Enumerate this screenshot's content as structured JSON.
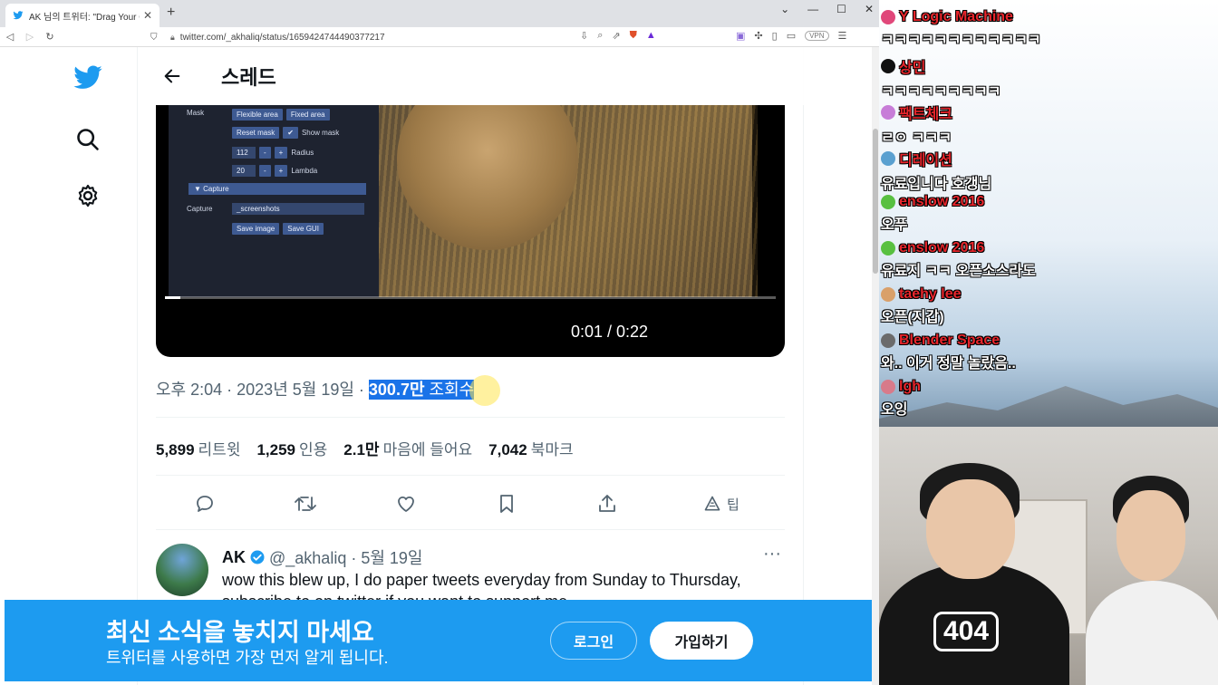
{
  "browser": {
    "tab_title": "AK 님의 트위터: \"Drag Your GAN",
    "tab_close": "✕",
    "new_tab": "+",
    "url": "twitter.com/_akhaliq/status/1659424744490377217",
    "vpn_label": "VPN",
    "window_controls": [
      "⌄",
      "—",
      "☐",
      "✕"
    ]
  },
  "header": {
    "title": "스레드"
  },
  "video_gui": {
    "mask_label": "Mask",
    "flexible_area": "Flexible area",
    "fixed_area": "Fixed area",
    "reset_mask": "Reset mask",
    "show_mask": "Show mask",
    "radius_value": "112",
    "radius_label": "Radius",
    "lambda_value": "20",
    "lambda_label": "Lambda",
    "capture_header": "Capture",
    "capture_label": "Capture",
    "capture_path": "_screenshots",
    "save_image": "Save image",
    "save_gui": "Save GUI",
    "minus": "-",
    "plus": "+"
  },
  "video": {
    "time": "0:01 / 0:22",
    "progress": 0.025
  },
  "tweet": {
    "meta_prefix": "오후 2:04 · 2023년 5월 19일 · ",
    "views_count": "300.7만",
    "views_label": " 조회수"
  },
  "stats": [
    {
      "count": "5,899",
      "label": "리트윗"
    },
    {
      "count": "1,259",
      "label": "인용"
    },
    {
      "count": "2.1만",
      "label": "마음에 들어요"
    },
    {
      "count": "7,042",
      "label": "북마크"
    }
  ],
  "actions": {
    "tip_label": "팁"
  },
  "reply": {
    "name": "AK",
    "handle_date": "@_akhaliq · 5월 19일",
    "more": "···",
    "text_line1": "wow this blew up, I do paper tweets everyday from Sunday to Thursday,",
    "text_line2": "subscribe to on twitter if you want to support me"
  },
  "banner": {
    "title": "최신 소식을 놓치지 마세요",
    "subtitle": "트위터를 사용하면 가장 먼저 알게 됩니다.",
    "login": "로그인",
    "signup": "가입하기"
  },
  "chat": [
    {
      "user": "Y Logic Machine",
      "msg": "ㅋㅋㅋㅋㅋㅋㅋㅋㅋㅋㅋㅋ",
      "badge": "#e0477a"
    },
    {
      "user": "상민",
      "msg": "ㅋㅋㅋㅋㅋㅋㅋㅋㅋ",
      "badge": "#111111"
    },
    {
      "user": "팩트체크",
      "msg": "ㄹㅇ ㅋㅋㅋ",
      "badge": "#c77dd8"
    },
    {
      "user": "디레이션",
      "msg": "유료입니다 호갱님",
      "badge": "#5aa0d0"
    },
    {
      "user": "enslow 2016",
      "msg": "오푸",
      "badge": "#58c040"
    },
    {
      "user": "enslow 2016",
      "msg": "유료지 ㅋㅋ 오픈소스라도",
      "badge": "#58c040"
    },
    {
      "user": "taehy lee",
      "msg": "오픈(지갑)",
      "badge": "#d9a06a"
    },
    {
      "user": "Blender Space",
      "msg": "와.. 이거 정말 놀랐음..",
      "badge": "#6b6b6b"
    },
    {
      "user": "lgh",
      "msg": "오잉",
      "badge": "#d87a8a"
    }
  ],
  "webcam": {
    "shirt_text": "404"
  },
  "colors": {
    "twitter_blue": "#1d9bf0",
    "chat_name": "#e8262c",
    "selection": "#1a73e8"
  }
}
